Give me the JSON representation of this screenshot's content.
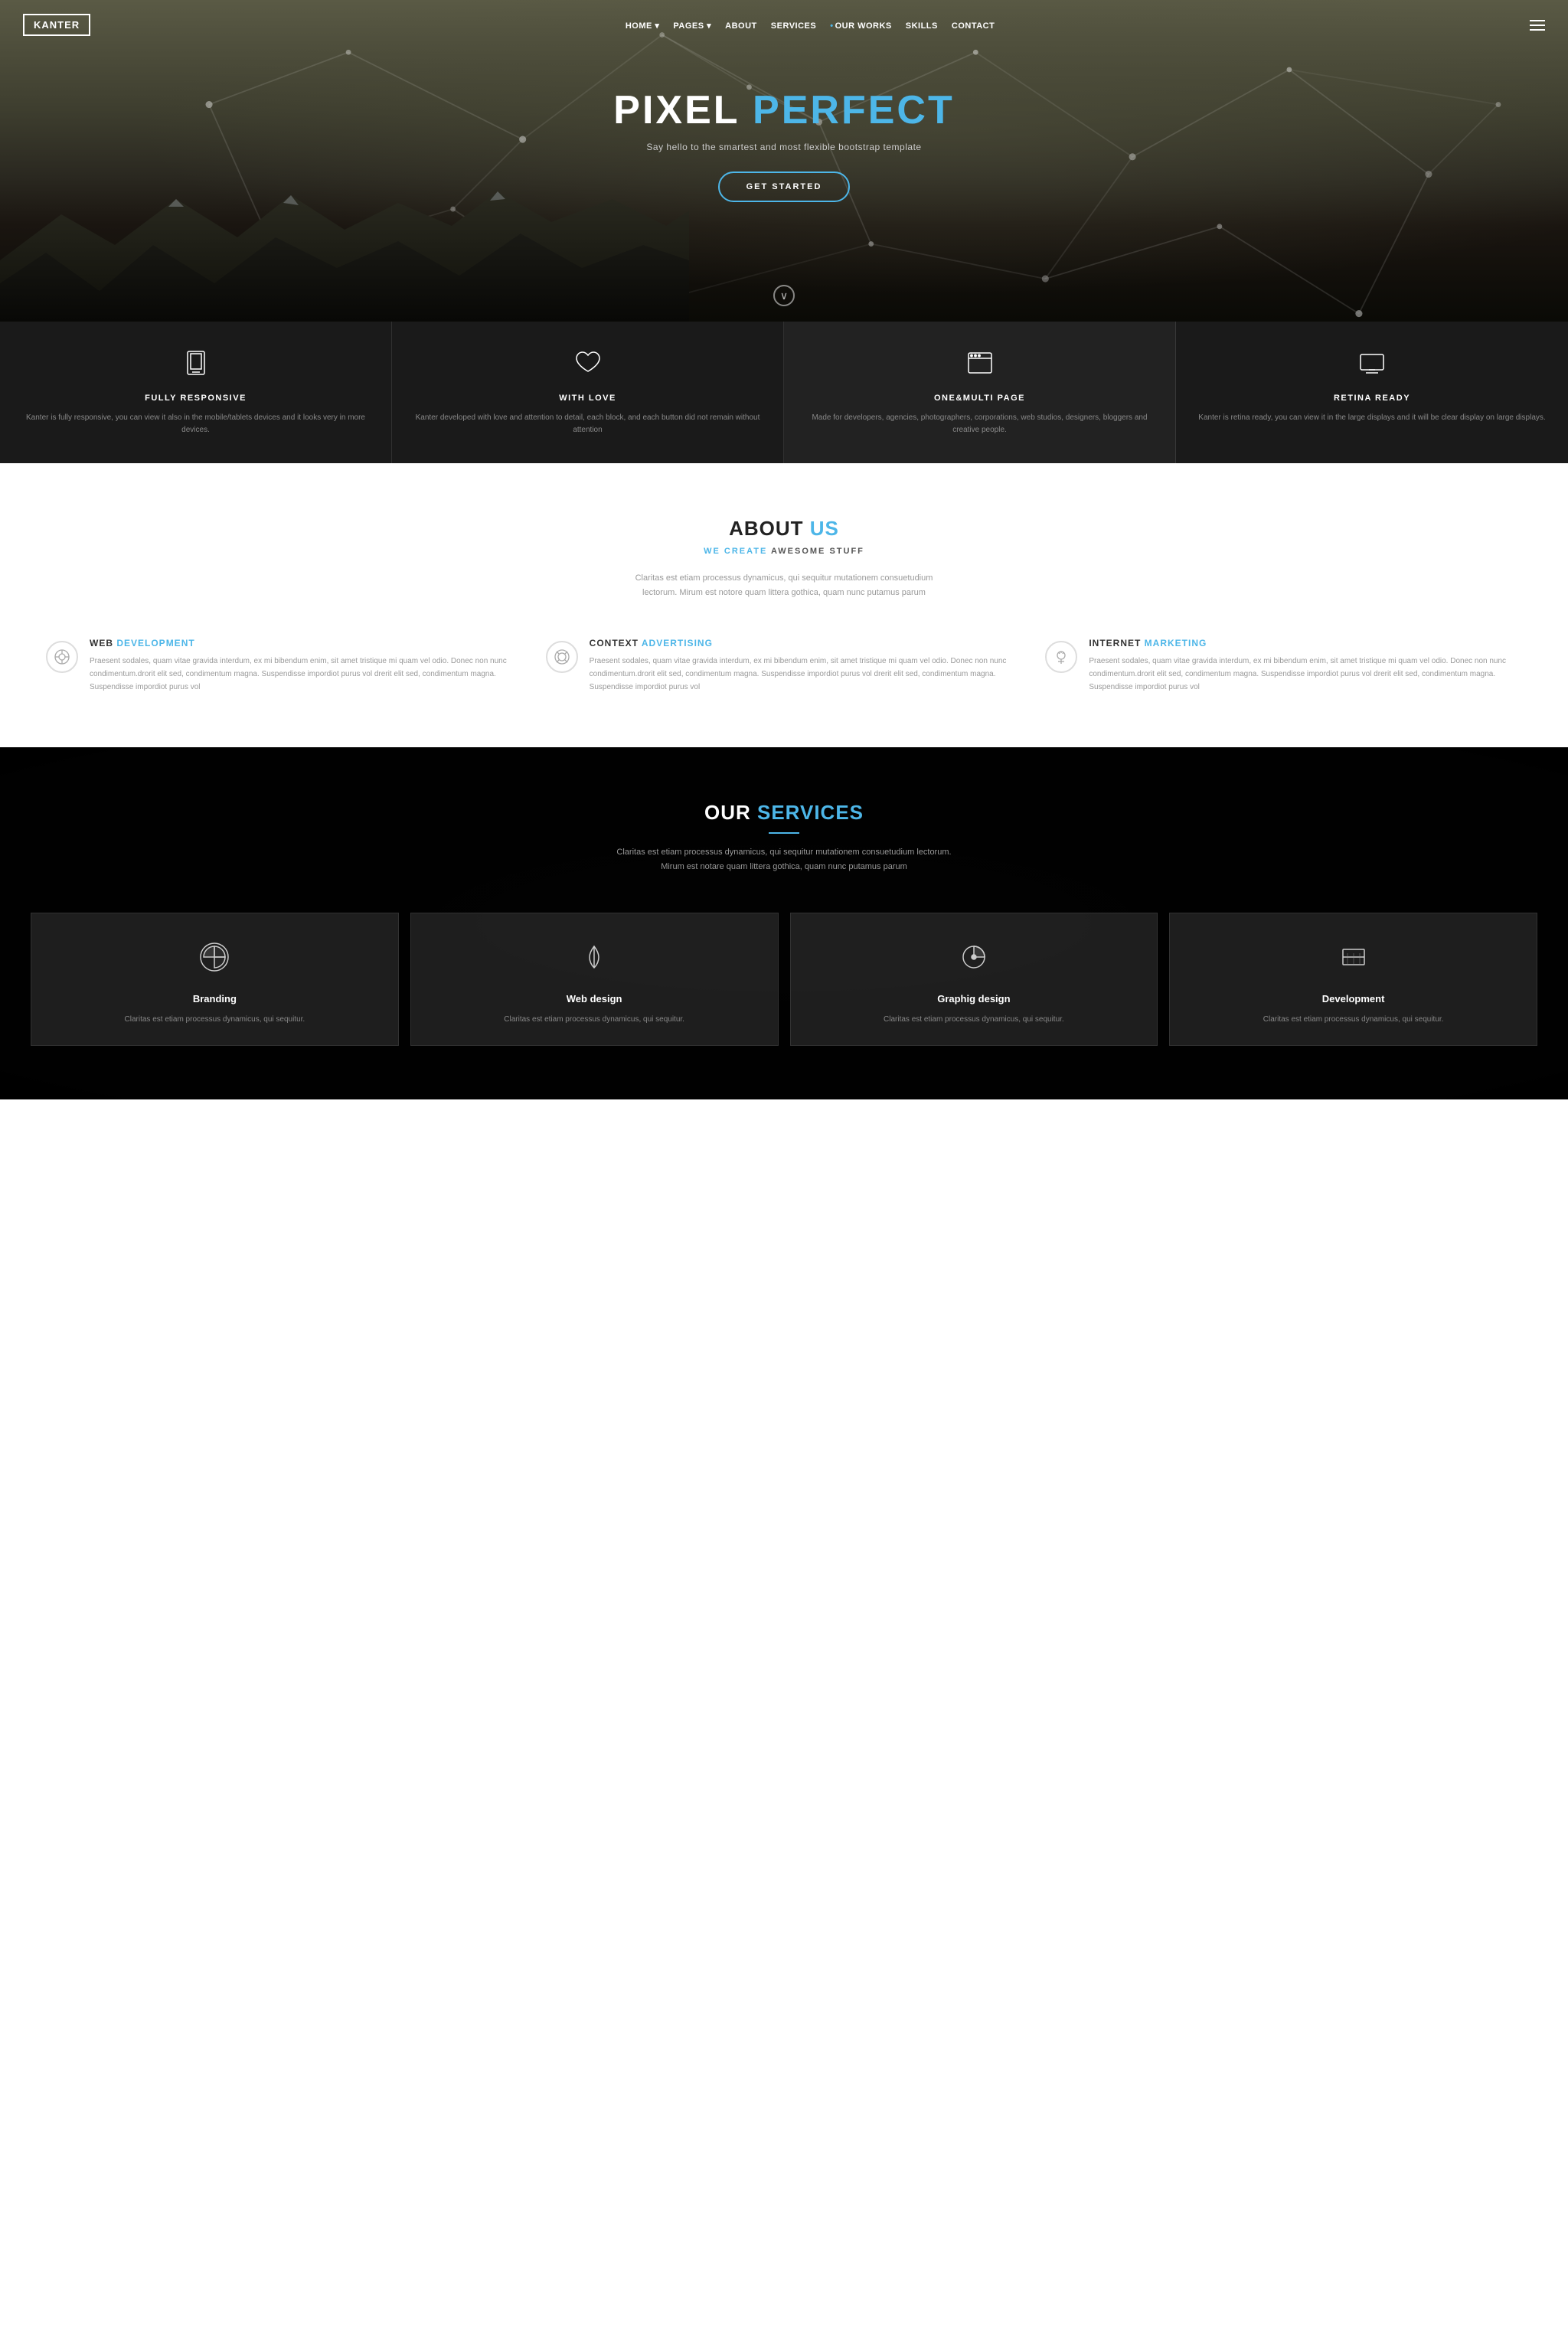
{
  "navbar": {
    "logo": "KANTER",
    "links": [
      {
        "label": "HOME",
        "has_dropdown": true,
        "has_dot": false
      },
      {
        "label": "PAGES",
        "has_dropdown": true,
        "has_dot": false
      },
      {
        "label": "ABOUT",
        "has_dropdown": false,
        "has_dot": false
      },
      {
        "label": "SERVICES",
        "has_dropdown": false,
        "has_dot": false
      },
      {
        "label": "OUR WORKS",
        "has_dropdown": false,
        "has_dot": true
      },
      {
        "label": "SKILLS",
        "has_dropdown": false,
        "has_dot": false
      },
      {
        "label": "CONTACT",
        "has_dropdown": false,
        "has_dot": false
      }
    ]
  },
  "hero": {
    "title_main": "PIXEL ",
    "title_highlight": "PERFECT",
    "subtitle": "Say hello to the smartest and most flexible bootstrap template",
    "cta_label": "GET STARTED",
    "scroll_icon": "∨"
  },
  "features": [
    {
      "title": "FULLY RESPONSIVE",
      "desc": "Kanter is fully responsive, you can view it also in the mobile/tablets devices and it looks very in more devices."
    },
    {
      "title": "WITH LOVE",
      "desc": "Kanter developed with love and attention to detail, each block, and each button did not remain without attention"
    },
    {
      "title": "ONE&MULTI PAGE",
      "desc": "Made for developers, agencies, photographers, corporations, web studios, designers, bloggers and creative people."
    },
    {
      "title": "RETINA READY",
      "desc": "Kanter is retina ready, you can view it in the large displays and it will be clear display on large displays."
    }
  ],
  "about": {
    "title_main": "ABOUT ",
    "title_highlight": "US",
    "subtitle_pre": "WE CREATE",
    "subtitle_post": " AWESOME STUFF",
    "desc": "Claritas est etiam processus dynamicus, qui sequitur mutationem consuetudium lectorum. Mirum est notore quam littera gothica, quam nunc putamus parum",
    "services": [
      {
        "title_pre": "WEB ",
        "title_hl": "DEVELOPMENT",
        "desc": "Praesent sodales, quam vitae gravida interdum, ex mi bibendum enim, sit amet tristique mi quam vel odio. Donec non nunc condimentum.drorit elit sed, condimentum magna. Suspendisse impordiot purus vol drerit elit sed, condimentum magna. Suspendisse impordiot purus vol"
      },
      {
        "title_pre": "CONTEXT ",
        "title_hl": "ADVERTISING",
        "desc": "Praesent sodales, quam vitae gravida interdum, ex mi bibendum enim, sit amet tristique mi quam vel odio. Donec non nunc condimentum.drorit elit sed, condimentum magna. Suspendisse impordiot purus vol drerit elit sed, condimentum magna. Suspendisse impordiot purus vol"
      },
      {
        "title_pre": "INTERNET ",
        "title_hl": "MARKETING",
        "desc": "Praesent sodales, quam vitae gravida interdum, ex mi bibendum enim, sit amet tristique mi quam vel odio. Donec non nunc condimentum.drorit elit sed, condimentum magna. Suspendisse impordiot purus vol drerit elit sed, condimentum magna. Suspendisse impordiot purus vol"
      }
    ]
  },
  "services_section": {
    "title_main": "OUR ",
    "title_highlight": "SERVICES",
    "desc": "Claritas est etiam processus dynamicus, qui sequitur mutationem consuetudium lectorum. Mirum est notare quam littera gothica, quam nunc putamus parum",
    "cards": [
      {
        "title": "Branding",
        "desc": "Claritas est etiam processus dynamicus, qui sequitur."
      },
      {
        "title": "Web design",
        "desc": "Claritas est etiam processus dynamicus, qui sequitur."
      },
      {
        "title": "Graphig design",
        "desc": "Claritas est etiam processus dynamicus, qui sequitur."
      },
      {
        "title": "Development",
        "desc": "Claritas est etiam processus dynamicus, qui sequitur."
      }
    ]
  }
}
